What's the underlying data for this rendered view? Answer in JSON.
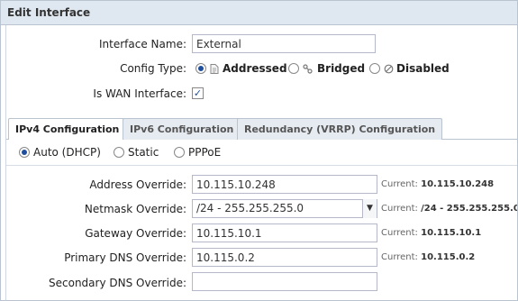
{
  "window": {
    "title": "Edit Interface"
  },
  "interface": {
    "name_label": "Interface Name:",
    "name_value": "External",
    "config_label": "Config Type:",
    "config_options": [
      {
        "label": "Addressed",
        "icon": "document-icon",
        "selected": true
      },
      {
        "label": "Bridged",
        "icon": "link-icon",
        "selected": false
      },
      {
        "label": "Disabled",
        "icon": "disabled-icon",
        "selected": false
      }
    ],
    "wan_label": "Is WAN Interface:",
    "wan_checked": true
  },
  "tabs": [
    {
      "label": "IPv4 Configuration",
      "active": true
    },
    {
      "label": "IPv6 Configuration",
      "active": false
    },
    {
      "label": "Redundancy (VRRP) Configuration",
      "active": false
    }
  ],
  "ipv4": {
    "modes": [
      {
        "label": "Auto (DHCP)",
        "selected": true
      },
      {
        "label": "Static",
        "selected": false
      },
      {
        "label": "PPPoE",
        "selected": false
      }
    ],
    "fields": [
      {
        "label": "Address Override:",
        "value": "10.115.10.248",
        "type": "text",
        "current_label": "Current:",
        "current_value": "10.115.10.248"
      },
      {
        "label": "Netmask Override:",
        "value": "/24 - 255.255.255.0",
        "type": "select",
        "current_label": "Current:",
        "current_value": "/24 - 255.255.255.0"
      },
      {
        "label": "Gateway Override:",
        "value": "10.115.10.1",
        "type": "text",
        "current_label": "Current:",
        "current_value": "10.115.10.1"
      },
      {
        "label": "Primary DNS Override:",
        "value": "10.115.0.2",
        "type": "text",
        "current_label": "Current:",
        "current_value": "10.115.0.2"
      },
      {
        "label": "Secondary DNS Override:",
        "value": "",
        "type": "text",
        "current_label": "",
        "current_value": ""
      }
    ]
  }
}
